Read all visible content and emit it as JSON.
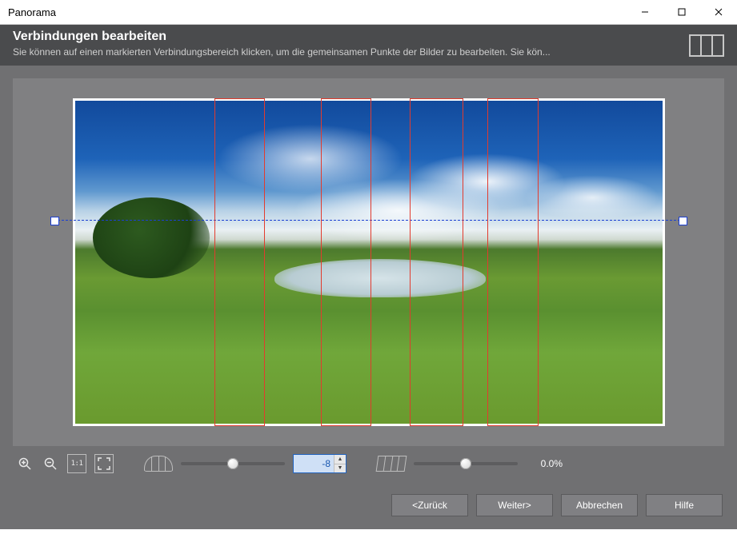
{
  "window": {
    "title": "Panorama"
  },
  "header": {
    "title": "Verbindungen bearbeiten",
    "subtitle": "Sie können auf einen markierten Verbindungsbereich klicken, um die gemeinsamen Punkte der Bilder zu bearbeiten. Sie kön..."
  },
  "preview": {
    "overlap_regions": [
      {
        "left_pct": 24.0,
        "width_pct": 8.2
      },
      {
        "left_pct": 42.0,
        "width_pct": 8.2
      },
      {
        "left_pct": 57.0,
        "width_pct": 8.8
      },
      {
        "left_pct": 70.0,
        "width_pct": 8.4
      }
    ],
    "horizon_pct": 37
  },
  "toolbar": {
    "zoom_in_icon": "zoom-in",
    "zoom_out_icon": "zoom-out",
    "actual_size_label": "1:1",
    "curvature": {
      "value": -8,
      "min": -100,
      "max": 100
    },
    "tilt": {
      "value_pct": 0.0,
      "display": "0.0%"
    }
  },
  "footer": {
    "back": "<Zurück",
    "next": "Weiter>",
    "cancel": "Abbrechen",
    "help": "Hilfe"
  }
}
